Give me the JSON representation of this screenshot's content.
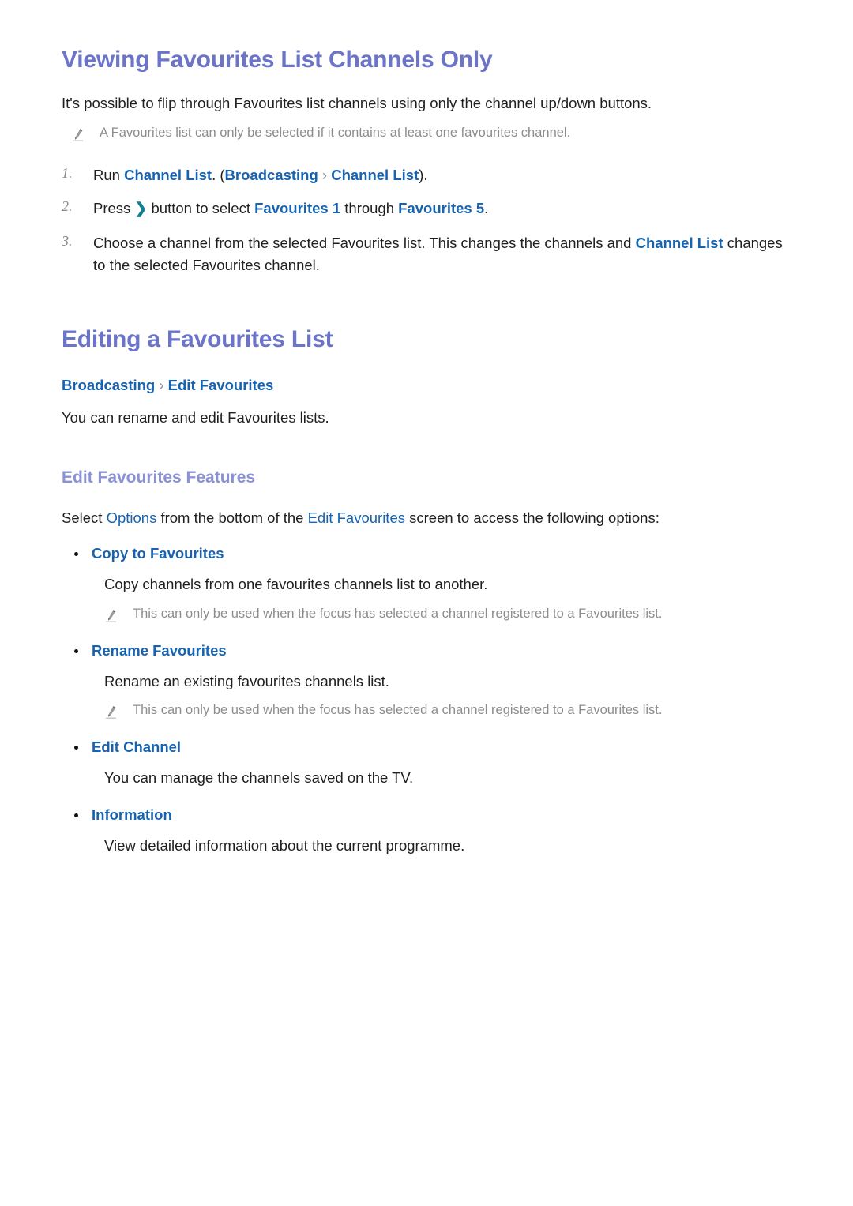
{
  "document": {
    "colors": {
      "heading": "#6b74c8",
      "subheading": "#8a91d4",
      "link": "#1763b0",
      "note_text": "#8c8c8c",
      "body_text": "#1f1f1f",
      "chevron_button": "#12818f",
      "breadcrumb_separator": "#8d8d8d"
    }
  },
  "section1": {
    "title": "Viewing Favourites List Channels Only",
    "intro": "It's possible to flip through Favourites list channels using only the channel up/down buttons.",
    "note": "A Favourites list can only be selected if it contains at least one favourites channel.",
    "note_icon": "pencil-icon",
    "steps": [
      {
        "number": "1.",
        "parts": [
          {
            "text": "Run ",
            "style": "plain"
          },
          {
            "text": "Channel List",
            "style": "link-bold"
          },
          {
            "text": ". (",
            "style": "plain"
          },
          {
            "text": "Broadcasting",
            "style": "link-bold"
          },
          {
            "text": " › ",
            "style": "separator"
          },
          {
            "text": "Channel List",
            "style": "link-bold"
          },
          {
            "text": ").",
            "style": "plain"
          }
        ]
      },
      {
        "number": "2.",
        "parts": [
          {
            "text": "Press ",
            "style": "plain"
          },
          {
            "text": "❯",
            "style": "chevron-button"
          },
          {
            "text": " button to select ",
            "style": "plain"
          },
          {
            "text": "Favourites 1",
            "style": "link-bold"
          },
          {
            "text": " through ",
            "style": "plain"
          },
          {
            "text": "Favourites 5",
            "style": "link-bold"
          },
          {
            "text": ".",
            "style": "plain"
          }
        ]
      },
      {
        "number": "3.",
        "parts": [
          {
            "text": "Choose a channel from the selected Favourites list. This changes the channels and ",
            "style": "plain"
          },
          {
            "text": "Channel List",
            "style": "link-bold"
          },
          {
            "text": " changes to the selected Favourites channel.",
            "style": "plain"
          }
        ]
      }
    ]
  },
  "section2": {
    "title": "Editing a Favourites List",
    "breadcrumb": {
      "first": "Broadcasting",
      "separator": "›",
      "second": "Edit Favourites"
    },
    "intro": "You can rename and edit Favourites lists.",
    "subheading": "Edit Favourites Features",
    "features_intro": {
      "parts": [
        {
          "text": "Select ",
          "style": "plain"
        },
        {
          "text": "Options",
          "style": "link"
        },
        {
          "text": " from the bottom of the ",
          "style": "plain"
        },
        {
          "text": "Edit Favourites",
          "style": "link"
        },
        {
          "text": " screen to access the following options:",
          "style": "plain"
        }
      ]
    },
    "options": [
      {
        "label": "Copy to Favourites",
        "description": "Copy channels from one favourites channels list to another.",
        "note": "This can only be used when the focus has selected a channel registered to a Favourites list.",
        "note_icon": "pencil-icon"
      },
      {
        "label": "Rename Favourites",
        "description": "Rename an existing favourites channels list.",
        "note": "This can only be used when the focus has selected a channel registered to a Favourites list.",
        "note_icon": "pencil-icon"
      },
      {
        "label": "Edit Channel",
        "description": "You can manage the channels saved on the TV.",
        "note": null,
        "note_icon": null
      },
      {
        "label": "Information",
        "description": "View detailed information about the current programme.",
        "note": null,
        "note_icon": null
      }
    ]
  }
}
